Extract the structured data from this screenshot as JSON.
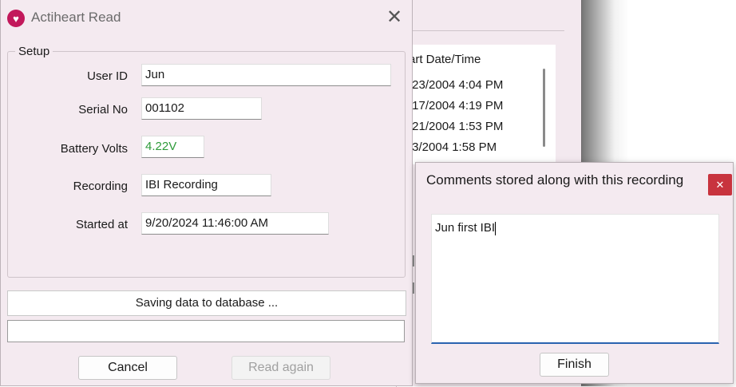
{
  "background_window": {
    "list_header": "art Date/Time",
    "rows": [
      "/23/2004 4:04 PM",
      "/17/2004 4:19 PM",
      "/21/2004 1:53 PM",
      "/3/2004 1:58 PM"
    ]
  },
  "main_dialog": {
    "title": "Actiheart Read",
    "close_glyph": "✕",
    "app_icon_glyph": "♥",
    "group_label": "Setup",
    "fields": {
      "user_id": {
        "label": "User ID",
        "value": "Jun"
      },
      "serial_no": {
        "label": "Serial No",
        "value": "001102"
      },
      "battery_volts": {
        "label": "Battery Volts",
        "value": "4.22V",
        "color": "#2e9b3a"
      },
      "recording": {
        "label": "Recording",
        "value": "IBI Recording"
      },
      "started_at": {
        "label": "Started at",
        "value": "9/20/2024 11:46:00 AM"
      }
    },
    "status_text": "Saving data to database ...",
    "progress": 0,
    "buttons": {
      "cancel": "Cancel",
      "read_again": "Read again"
    }
  },
  "comments_dialog": {
    "title": "Comments stored along with this recording",
    "close_glyph": "✕",
    "comment_text": "Jun first IBI",
    "finish_label": "Finish",
    "accent_color": "#2a63b0",
    "close_color": "#c8343e"
  }
}
